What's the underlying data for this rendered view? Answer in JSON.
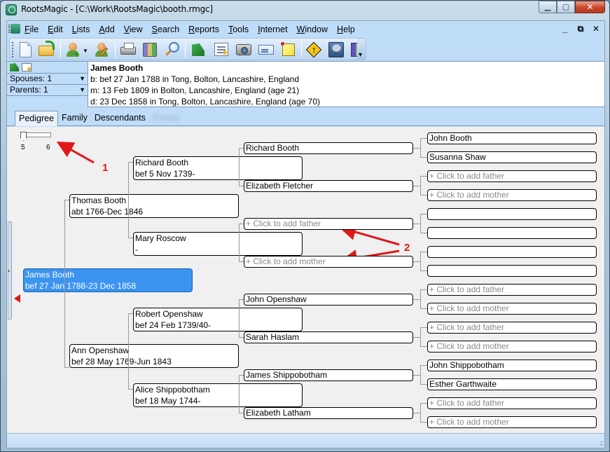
{
  "window": {
    "title": "RootsMagic - [C:\\Work\\RootsMagic\\booth.rmgc]",
    "controls": {
      "minimize": "—",
      "maximize": "▭",
      "close": "✕"
    }
  },
  "menubar": {
    "items": [
      {
        "label_u": "F",
        "label_rest": "ile"
      },
      {
        "label_u": "E",
        "label_rest": "dit"
      },
      {
        "label_u": "L",
        "label_rest": "ists"
      },
      {
        "label_u": "A",
        "label_rest": "dd"
      },
      {
        "label_u": "V",
        "label_rest": "iew"
      },
      {
        "label_u": "S",
        "label_rest": "earch"
      },
      {
        "label_u": "R",
        "label_rest": "eports"
      },
      {
        "label_u": "T",
        "label_rest": "ools"
      },
      {
        "label_u": "I",
        "label_rest": "nternet"
      },
      {
        "label_u": "W",
        "label_rest": "indow"
      },
      {
        "label_u": "H",
        "label_rest": "elp"
      }
    ],
    "mdi_controls": {
      "minimize": "_",
      "restore": "🗗",
      "close": "✕"
    }
  },
  "toolbar": {
    "buttons": [
      "new-file-icon",
      "open-file-icon",
      "add-person-icon",
      "edit-person-icon",
      "print-icon",
      "books-icon",
      "search-icon",
      "publisher-icon",
      "certificate-icon",
      "camera-icon",
      "card-icon",
      "note-icon",
      "merge-sign-icon",
      "tree-icon",
      "exit-door-icon"
    ]
  },
  "info": {
    "spouses": "Spouses: 1",
    "parents": "Parents: 1",
    "name": "James Booth",
    "birth": "b: bef 27 Jan 1788 in Tong, Bolton, Lancashire, England",
    "marriage": "m: 13 Feb 1809 in Bolton, Lancashire, England (age 21)",
    "death": "d: 23 Dec 1858 in Tong, Bolton, Lancashire, England (age 70)"
  },
  "tabs": [
    {
      "label": "Pedigree",
      "active": true
    },
    {
      "label": "Family",
      "active": false
    },
    {
      "label": "Descendants",
      "active": false
    },
    {
      "label": "People",
      "active": false
    }
  ],
  "slider": {
    "min_label": "5",
    "max_label": "6",
    "value": 5
  },
  "pedigree": {
    "root": {
      "name": "James Booth",
      "dates": "bef 27 Jan 1788-23 Dec 1858"
    },
    "gen2": [
      {
        "name": "Thomas Booth",
        "dates": "abt 1766-Dec 1846"
      },
      {
        "name": "Ann Openshaw",
        "dates": "bef 28 May 1769-Jun 1843"
      }
    ],
    "gen3": [
      {
        "name": "Richard Booth",
        "dates": "bef 5 Nov 1739-"
      },
      {
        "name": "Mary Roscow",
        "dates": "-"
      },
      {
        "name": "Robert Openshaw",
        "dates": "bef 24 Feb 1739/40-"
      },
      {
        "name": "Alice Shippobotham",
        "dates": "bef 18 May 1744-"
      }
    ],
    "gen4": [
      {
        "name": "Richard Booth",
        "placeholder": false
      },
      {
        "name": "Elizabeth Fletcher",
        "placeholder": false
      },
      {
        "name": "+ Click to add father",
        "placeholder": true
      },
      {
        "name": "+ Click to add mother",
        "placeholder": true
      },
      {
        "name": "John Openshaw",
        "placeholder": false
      },
      {
        "name": "Sarah Haslam",
        "placeholder": false
      },
      {
        "name": "James Shippobotham",
        "placeholder": false
      },
      {
        "name": "Elizabeth Latham",
        "placeholder": false
      }
    ],
    "gen5": [
      {
        "name": "John Booth",
        "placeholder": false
      },
      {
        "name": "Susanna Shaw",
        "placeholder": false
      },
      {
        "name": "+ Click to add father",
        "placeholder": true
      },
      {
        "name": "+ Click to add mother",
        "placeholder": true
      },
      {
        "name": "",
        "placeholder": false
      },
      {
        "name": "",
        "placeholder": false
      },
      {
        "name": "",
        "placeholder": false
      },
      {
        "name": "",
        "placeholder": false
      },
      {
        "name": "+ Click to add father",
        "placeholder": true
      },
      {
        "name": "+ Click to add mother",
        "placeholder": true
      },
      {
        "name": "+ Click to add father",
        "placeholder": true
      },
      {
        "name": "+ Click to add mother",
        "placeholder": true
      },
      {
        "name": "John Shippobotham",
        "placeholder": false
      },
      {
        "name": "Esther Garthwaite",
        "placeholder": false
      },
      {
        "name": "+ Click to add father",
        "placeholder": true
      },
      {
        "name": "+ Click to add mother",
        "placeholder": true
      }
    ]
  },
  "annotations": {
    "label1": "1",
    "label2": "2",
    "color": "#e01818"
  },
  "colors": {
    "selected_box": "#3b94f0",
    "placeholder_text": "#8a8a8a",
    "chrome_blue": "#bfdcf9"
  }
}
